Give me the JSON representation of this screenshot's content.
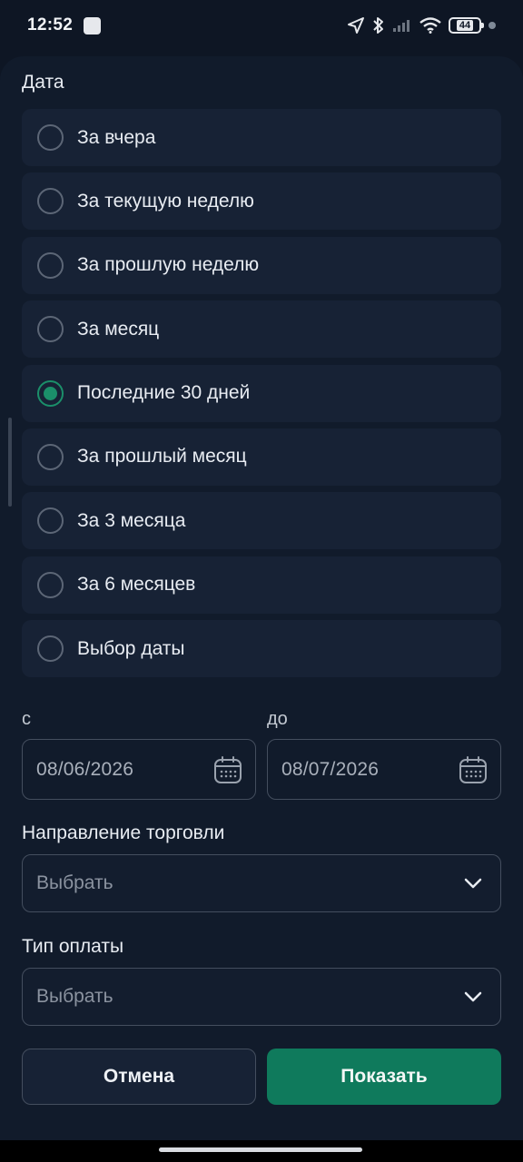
{
  "status_bar": {
    "time": "12:52",
    "battery": "44"
  },
  "date_section": {
    "title": "Дата",
    "options": [
      {
        "label": "За вчера",
        "selected": false
      },
      {
        "label": "За текущую  неделю",
        "selected": false
      },
      {
        "label": "За прошлую неделю",
        "selected": false
      },
      {
        "label": "За месяц",
        "selected": false
      },
      {
        "label": "Последние 30 дней",
        "selected": true
      },
      {
        "label": "За прошлый месяц",
        "selected": false
      },
      {
        "label": "За 3 месяца",
        "selected": false
      },
      {
        "label": "За 6 месяцев",
        "selected": false
      },
      {
        "label": "Выбор даты",
        "selected": false
      }
    ]
  },
  "range": {
    "from_label": "с",
    "to_label": "до",
    "from_value": "08/06/2026",
    "to_value": "08/07/2026"
  },
  "trade_direction": {
    "title": "Направление торговли",
    "placeholder": "Выбрать"
  },
  "payment_type": {
    "title": "Тип оплаты",
    "placeholder": "Выбрать"
  },
  "actions": {
    "cancel_label": "Отмена",
    "show_label": "Показать"
  },
  "colors": {
    "accent": "#1b8f6a",
    "primary_button": "#0f7a5c",
    "background": "#111b2b",
    "card": "#172235"
  }
}
